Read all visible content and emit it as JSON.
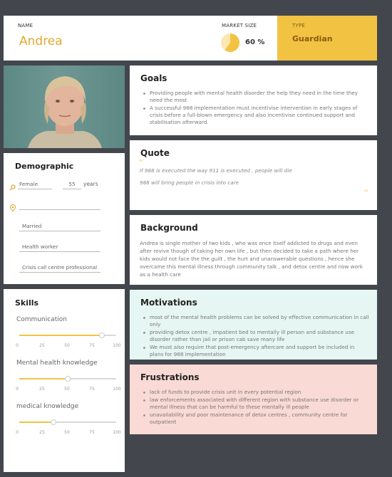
{
  "colors": {
    "background": "#43474d",
    "accent": "#f2c343",
    "motivations_bg": "#e6f6f2",
    "frustrations_bg": "#fadad4"
  },
  "header": {
    "name_label": "NAME",
    "name": "Andrea",
    "market_label": "MARKET SIZE",
    "market_value": "60 %",
    "market_fraction": 0.6,
    "type_label": "TYPE",
    "type_value": "Guardian"
  },
  "demographic": {
    "title": "Demographic",
    "gender": "Female",
    "age": "55",
    "age_unit": "years",
    "location": "",
    "status": "Married",
    "occupation": "Health worker",
    "role": "Crisis call centre professional"
  },
  "goals": {
    "title": "Goals",
    "items": [
      "Providing people with mental health disorder the help they need in the time they need the most",
      "A successful 988 implementation must incentivise intervention in early stages of crisis before a full-blown emergency and also incentivise continued support and stabilisation afterward."
    ]
  },
  "quote": {
    "title": "Quote",
    "line1": "If 988 is executed the way 911 is executed , people will die",
    "line2": "988 will bring people in crisis into care"
  },
  "background": {
    "title": "Background",
    "text": "Andrea is single mother of two kids , who was once itself addicted to drugs and even after revive though of taking her own life , but then decided to take a path where her kids would not face the the guilt , the hurt and unanswerable questions , hence she overcame this mental illness through community talk , and detox centre and now work as a health care"
  },
  "skills": {
    "title": "Skills",
    "ticks": [
      "0",
      "25",
      "50",
      "75",
      "100"
    ],
    "items": [
      {
        "name": "Communication",
        "value": 85
      },
      {
        "name": "Mental health knowledge",
        "value": 50
      },
      {
        "name": "medical knowledge",
        "value": 35
      }
    ]
  },
  "motivations": {
    "title": "Motivations",
    "items": [
      "most of the mental health problems can be solved by effective communication in call only",
      "providing detox centre , impatient bed to mentally ill person and substance use disorder rather than jail or prison cab save many life",
      "We must also require that post-emergency aftercare and support be included in plans for 988 implementation"
    ]
  },
  "frustrations": {
    "title": "Frustrations",
    "items": [
      "lack of funds to provide crisis unit in every potential region",
      "law enforcements associated with different region with substance use disorder or mental illness that can be harmful to these mentally ill people",
      "unavailability and poor maintenance of detox centres , community centre for outpatient"
    ]
  }
}
